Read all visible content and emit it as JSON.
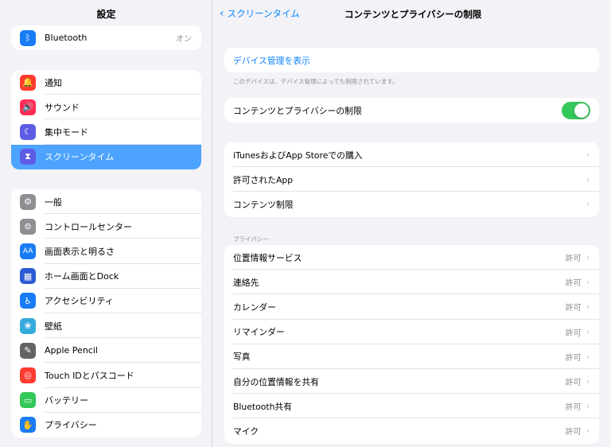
{
  "sidebar": {
    "title": "設定",
    "group1": [
      {
        "label": "Bluetooth",
        "value": "オン",
        "icon": "bluetooth-icon",
        "color": "#1a7cf5",
        "glyph": "ᛒ"
      }
    ],
    "group2": [
      {
        "label": "通知",
        "icon": "notifications-icon",
        "color": "#ff3b30",
        "glyph": "🔔"
      },
      {
        "label": "サウンド",
        "icon": "sound-icon",
        "color": "#ff2d55",
        "glyph": "🔊"
      },
      {
        "label": "集中モード",
        "icon": "focus-moon-icon",
        "color": "#5e5ce6",
        "glyph": "☾"
      },
      {
        "label": "スクリーンタイム",
        "icon": "hourglass-icon",
        "color": "#5e5ce6",
        "glyph": "⧗",
        "selected": true
      }
    ],
    "group3": [
      {
        "label": "一般",
        "icon": "gear-icon",
        "color": "#8e8e93",
        "glyph": "⚙"
      },
      {
        "label": "コントロールセンター",
        "icon": "control-center-icon",
        "color": "#8e8e93",
        "glyph": "⊜"
      },
      {
        "label": "画面表示と明るさ",
        "icon": "display-brightness-icon",
        "color": "#1a7cf5",
        "glyph": "AA"
      },
      {
        "label": "ホーム画面とDock",
        "icon": "home-screen-icon",
        "color": "#2c5bd6",
        "glyph": "▦"
      },
      {
        "label": "アクセシビリティ",
        "icon": "accessibility-icon",
        "color": "#1a7cf5",
        "glyph": "♿"
      },
      {
        "label": "壁紙",
        "icon": "wallpaper-icon",
        "color": "#34aadc",
        "glyph": "❀"
      },
      {
        "label": "Apple Pencil",
        "icon": "pencil-icon",
        "color": "#636366",
        "glyph": "✎"
      },
      {
        "label": "Touch IDとパスコード",
        "icon": "fingerprint-icon",
        "color": "#ff3b30",
        "glyph": "◎"
      },
      {
        "label": "バッテリー",
        "icon": "battery-icon",
        "color": "#34c759",
        "glyph": "▭"
      },
      {
        "label": "プライバシー",
        "icon": "privacy-hand-icon",
        "color": "#1a7cf5",
        "glyph": "✋"
      }
    ]
  },
  "nav": {
    "back_label": "スクリーンタイム",
    "title": "コンテンツとプライバシーの制限"
  },
  "device_management": {
    "link": "デバイス管理を表示",
    "footnote": "このデバイスは、デバイス管理によっても制限されています。"
  },
  "restrictions_toggle": {
    "label": "コンテンツとプライバシーの制限",
    "enabled": true
  },
  "content_rows": [
    {
      "label": "iTunesおよびApp Storeでの購入"
    },
    {
      "label": "許可されたApp"
    },
    {
      "label": "コンテンツ制限"
    }
  ],
  "privacy": {
    "header": "プライバシー",
    "rows": [
      {
        "label": "位置情報サービス",
        "value": "許可"
      },
      {
        "label": "連絡先",
        "value": "許可"
      },
      {
        "label": "カレンダー",
        "value": "許可"
      },
      {
        "label": "リマインダー",
        "value": "許可"
      },
      {
        "label": "写真",
        "value": "許可"
      },
      {
        "label": "自分の位置情報を共有",
        "value": "許可"
      },
      {
        "label": "Bluetooth共有",
        "value": "許可"
      },
      {
        "label": "マイク",
        "value": "許可"
      }
    ]
  }
}
